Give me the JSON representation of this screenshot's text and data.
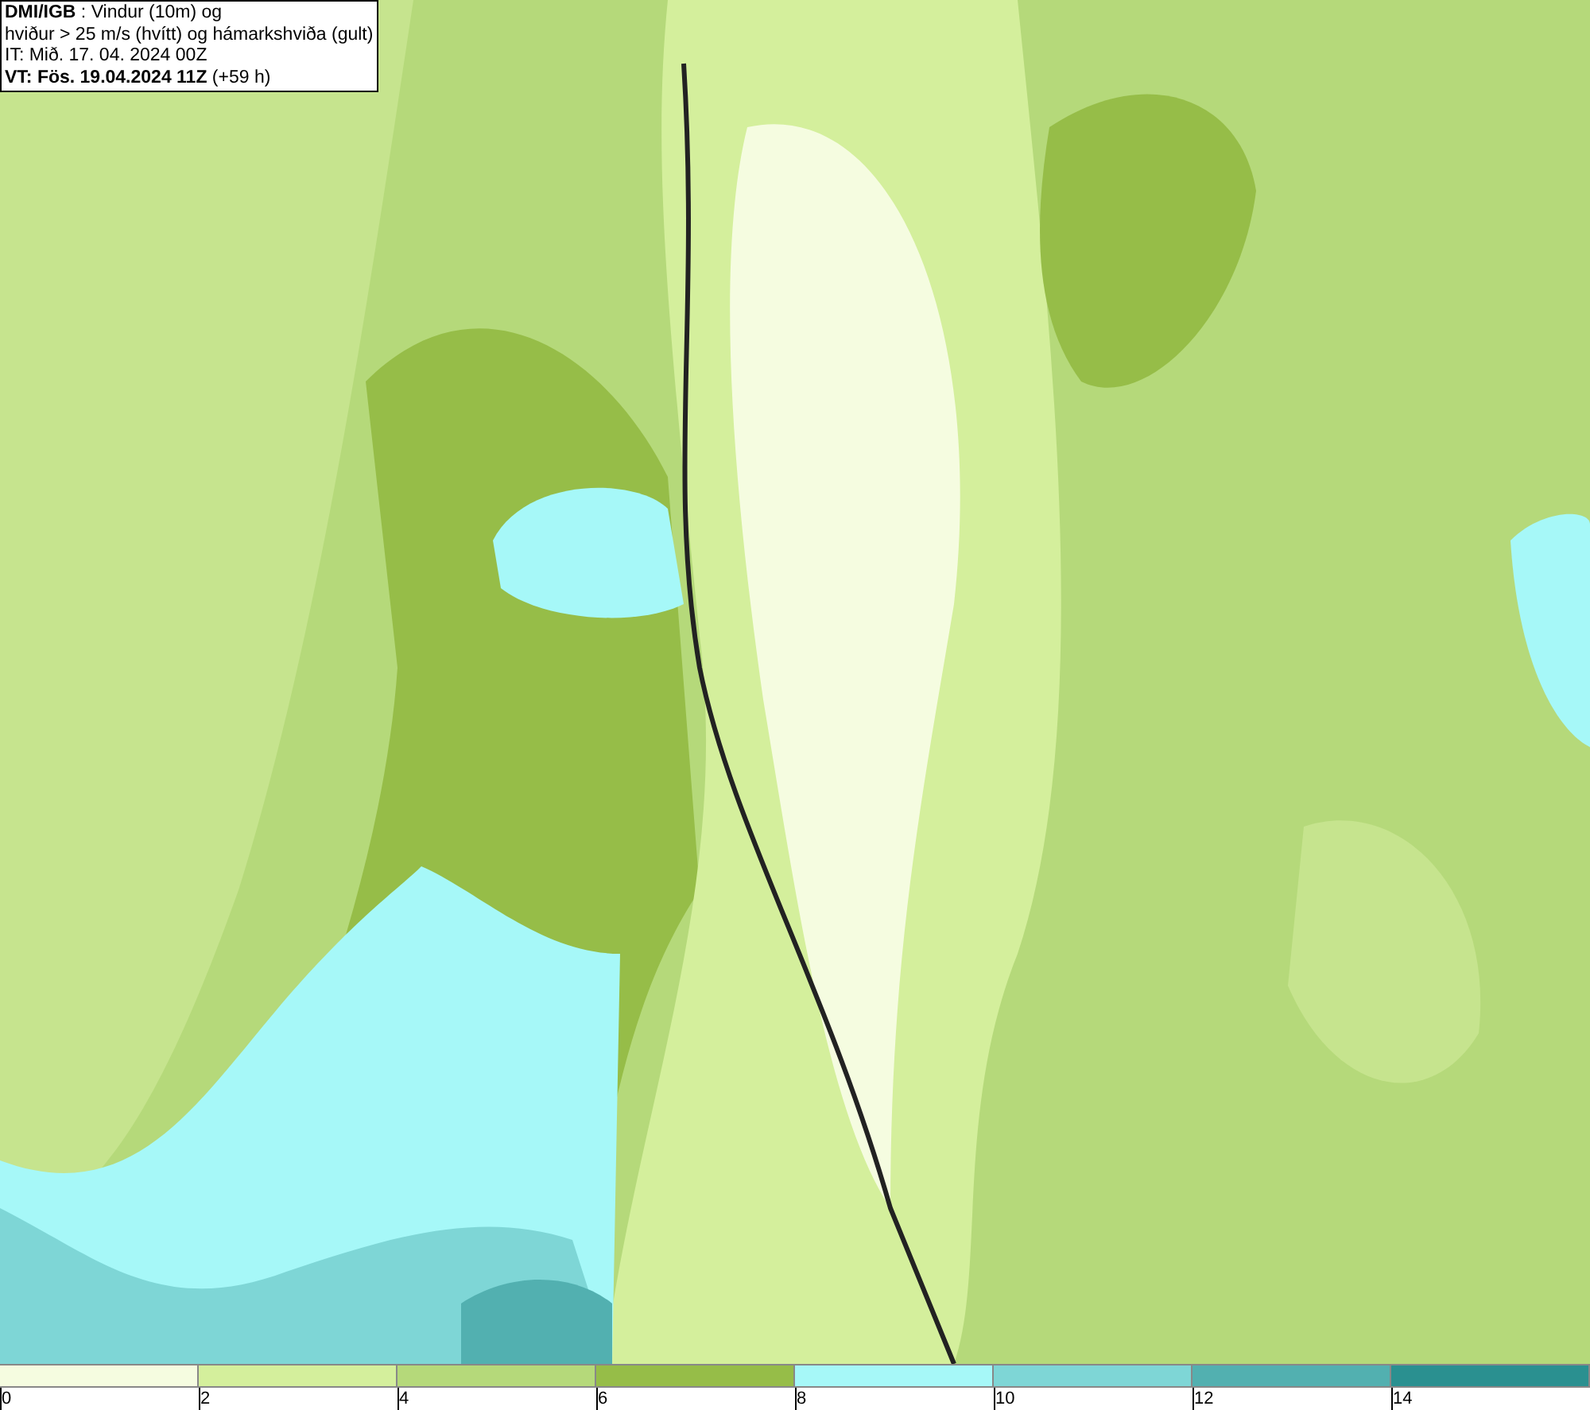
{
  "header": {
    "lines": [
      "**DMI/IGB** : Vindur (10m) og",
      "hviður > 25 m/s (hvítt) og hámarkshviða (gult)",
      "IT: Mið. 17. 04. 2024 00Z",
      "**VT: Fös. 19.04.2024 11Z** (+59 h)"
    ]
  },
  "legend": {
    "segments": [
      {
        "color": "#f5fce0",
        "label": "0"
      },
      {
        "color": "#d4ef9c",
        "label": "2"
      },
      {
        "color": "#b5d97a",
        "label": "4"
      },
      {
        "color": "#96bd48",
        "label": "6"
      },
      {
        "color": "#a6f8f8",
        "label": "8"
      },
      {
        "color": "#7ed6d6",
        "label": "10"
      },
      {
        "color": "#52b0b0",
        "label": "12"
      },
      {
        "color": "#2a9090",
        "label": "14"
      }
    ]
  }
}
